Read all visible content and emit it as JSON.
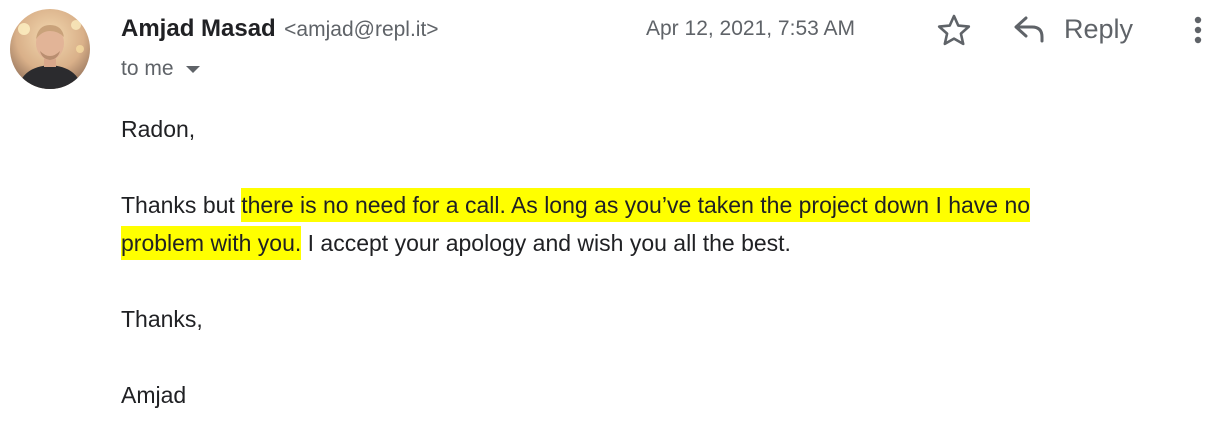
{
  "sender": {
    "name": "Amjad Masad",
    "email": "<amjad@repl.it>",
    "avatar_alt": "Amjad Masad avatar"
  },
  "recipient": {
    "label": "to me"
  },
  "timestamp": "Apr 12, 2021, 7:53 AM",
  "actions": {
    "star_icon": "star-outline",
    "reply_icon": "reply-arrow",
    "reply_label": "Reply",
    "more_icon": "vertical-dots"
  },
  "message": {
    "greeting": "Radon,",
    "main_lead": "Thanks but ",
    "main_highlight_1": "there is no need for a call. As long as you’ve taken the project down I have no",
    "main_highlight_2": "problem with you.",
    "main_tail": " I accept your apology and wish you all the best.",
    "signoff": "Thanks,",
    "signature": "Amjad"
  },
  "colors": {
    "highlight": "#ffff00",
    "secondary_text": "#5f6368",
    "primary_text": "#202124"
  }
}
